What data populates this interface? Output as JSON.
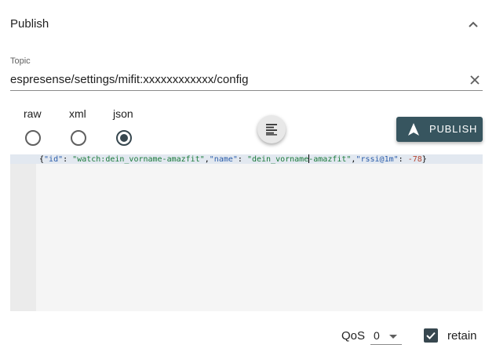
{
  "panel": {
    "title": "Publish"
  },
  "topic": {
    "label": "Topic",
    "value": "espresense/settings/mifit:xxxxxxxxxxxx/config"
  },
  "formats": [
    {
      "label": "raw",
      "checked": false
    },
    {
      "label": "xml",
      "checked": false
    },
    {
      "label": "json",
      "checked": true
    }
  ],
  "publish_button": {
    "label": "PUBLISH"
  },
  "editor": {
    "line": {
      "t1": "{",
      "k1": "\"id\"",
      "t2": ": ",
      "v1": "\"watch:dein_vorname-amazfit\"",
      "t3": ",",
      "k2": "\"name\"",
      "t4": ": ",
      "v2a": "\"dein_vorname",
      "v2b": "-amazfit\"",
      "t5": ",",
      "k3": "\"rssi@1m\"",
      "t6": ": ",
      "n1": "-78",
      "t7": "}"
    }
  },
  "qos": {
    "label": "QoS",
    "value": "0"
  },
  "retain": {
    "label": "retain",
    "checked": true
  },
  "icons": {
    "collapse": "chevron-up-icon",
    "clear": "close-icon",
    "format": "format-align-icon",
    "publish": "navigation-arrow-icon",
    "dropdown": "caret-down-icon",
    "checkbox": "check-icon"
  },
  "colors": {
    "accent": "#37474f",
    "publish_button": "#37555f",
    "editor_bg": "#f5f5f5",
    "gutter_bg": "#ebebeb"
  }
}
